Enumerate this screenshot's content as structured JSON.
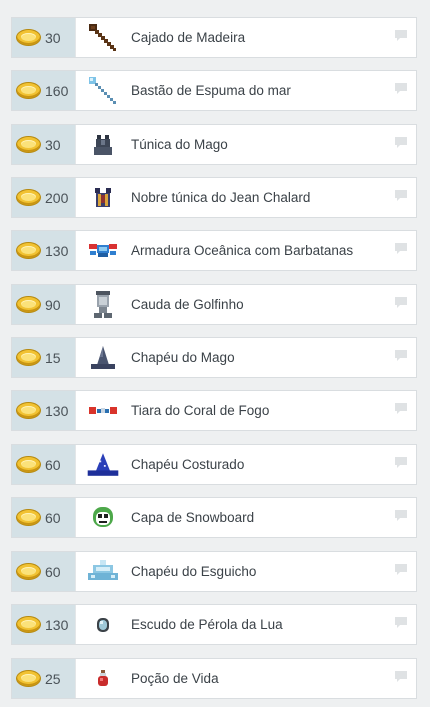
{
  "items": [
    {
      "price": "30",
      "name": "Cajado de Madeira",
      "icon": "wooden-staff-icon"
    },
    {
      "price": "160",
      "name": "Bastão de Espuma do mar",
      "icon": "seafoam-staff-icon"
    },
    {
      "price": "30",
      "name": "Túnica do Mago",
      "icon": "wizard-robe-icon"
    },
    {
      "price": "200",
      "name": "Nobre túnica do Jean Chalard",
      "icon": "jean-chalard-robe-icon"
    },
    {
      "price": "130",
      "name": "Armadura Oceânica com Barbatanas",
      "icon": "finned-ocean-armor-icon"
    },
    {
      "price": "90",
      "name": "Cauda de Golfinho",
      "icon": "dolphin-tail-icon"
    },
    {
      "price": "15",
      "name": "Chapéu do Mago",
      "icon": "wizard-hat-icon"
    },
    {
      "price": "130",
      "name": "Tiara do Coral de Fogo",
      "icon": "fire-coral-tiara-icon"
    },
    {
      "price": "60",
      "name": "Chapéu Costurado",
      "icon": "stitched-hat-icon"
    },
    {
      "price": "60",
      "name": "Capa de Snowboard",
      "icon": "snowboard-hood-icon"
    },
    {
      "price": "60",
      "name": "Chapéu do Esguicho",
      "icon": "splash-hat-icon"
    },
    {
      "price": "130",
      "name": "Escudo de Pérola da Lua",
      "icon": "moon-pearl-shield-icon"
    },
    {
      "price": "25",
      "name": "Poção de Vida",
      "icon": "health-potion-icon"
    }
  ],
  "colors": {
    "price_bg": "#d4e1e6",
    "coin": "#f1c232",
    "text": "#3b4248"
  }
}
